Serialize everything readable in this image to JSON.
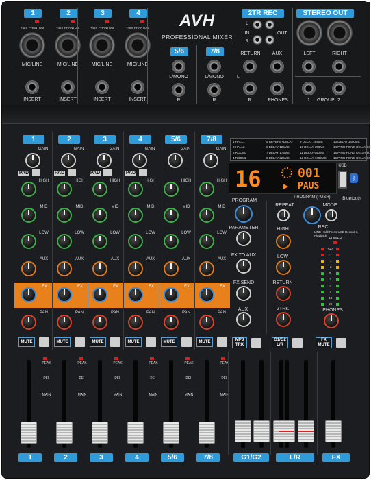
{
  "brand": {
    "logo": "AVH",
    "subtitle": "PROFESSIONAL MIXER"
  },
  "top_panel": {
    "mono_channels": [
      {
        "number": "1",
        "phantom": "+48V PHANTOM",
        "input": "MIC/LINE",
        "insert": "INSERT"
      },
      {
        "number": "2",
        "phantom": "+48V PHANTOM",
        "input": "MIC/LINE",
        "insert": "INSERT"
      },
      {
        "number": "3",
        "phantom": "+48V PHANTOM",
        "input": "MIC/LINE",
        "insert": "INSERT"
      },
      {
        "number": "4",
        "phantom": "+48V PHANTOM",
        "input": "MIC/LINE",
        "insert": "INSERT"
      }
    ],
    "stereo_channels": [
      {
        "number": "5/6",
        "left": "L/MONO",
        "right": "R"
      },
      {
        "number": "7/8",
        "left": "L/MONO",
        "right": "R"
      }
    ],
    "tr2_rec": {
      "title": "2TR REC",
      "in": "IN",
      "out": "OUT",
      "l": "L",
      "r": "R",
      "return": "RETURN",
      "aux": "AUX",
      "phones": "PHONES"
    },
    "stereo_out": {
      "title": "STEREO OUT",
      "left": "LEFT",
      "right": "RIGHT",
      "group": "GROUP",
      "g1": "1",
      "g2": "2"
    }
  },
  "channels": [
    {
      "label": "1",
      "gain": "GAIN",
      "pad": "PAD",
      "high": "HIGH",
      "mid": "MID",
      "low": "LOW",
      "aux": "AUX",
      "fx": "FX",
      "pan": "PAN",
      "mute": "MUTE",
      "peak": "PEAK",
      "pfl": "PFL",
      "main": "MAIN"
    },
    {
      "label": "2",
      "gain": "GAIN",
      "pad": "PAD",
      "high": "HIGH",
      "mid": "MID",
      "low": "LOW",
      "aux": "AUX",
      "fx": "FX",
      "pan": "PAN",
      "mute": "MUTE",
      "peak": "PEAK",
      "pfl": "PFL",
      "main": "MAIN"
    },
    {
      "label": "3",
      "gain": "GAIN",
      "pad": "PAD",
      "high": "HIGH",
      "mid": "MID",
      "low": "LOW",
      "aux": "AUX",
      "fx": "FX",
      "pan": "PAN",
      "mute": "MUTE",
      "peak": "PEAK",
      "pfl": "PFL",
      "main": "MAIN"
    },
    {
      "label": "4",
      "gain": "GAIN",
      "pad": "PAD",
      "high": "HIGH",
      "mid": "MID",
      "low": "LOW",
      "aux": "AUX",
      "fx": "FX",
      "pan": "PAN",
      "mute": "MUTE",
      "peak": "PEAK",
      "pfl": "PFL",
      "main": "MAIN"
    },
    {
      "label": "5/6",
      "gain": "GAIN",
      "pad": "",
      "high": "HIGH",
      "mid": "MID",
      "low": "LOW",
      "aux": "AUX",
      "fx": "FX",
      "pan": "PAN",
      "mute": "MUTE",
      "peak": "PEAK",
      "pfl": "PFL",
      "main": "MAIN"
    },
    {
      "label": "7/8",
      "gain": "GAIN",
      "pad": "",
      "high": "HIGH",
      "mid": "MID",
      "low": "LOW",
      "aux": "AUX",
      "fx": "FX",
      "pan": "PAN",
      "mute": "MUTE",
      "peak": "PEAK",
      "pfl": "PFL",
      "main": "MAIN"
    }
  ],
  "fx_presets": [
    "1 HALL1",
    "2 HALL2",
    "3 ROOM1",
    "4 ROOM2",
    "5 REVERB+DELAY",
    "6 DELAY 125MS",
    "7 DELAY 175MS",
    "8 DELAY 225MS",
    "9 DELAY 285MS",
    "10 DELAY 350MS",
    "11 DELAY 650MS",
    "12 DELAY 1000MS",
    "13 DELAY 1400MS",
    "14 PING-PONG DELAY 600MS",
    "15 PING-PONG DELAY 800MS",
    "16 PING-PONG DELAY 900MS"
  ],
  "display": {
    "preset": "16",
    "track": "001",
    "status": "PAUS",
    "usb": "USB",
    "bluetooth": "Bluetooth"
  },
  "master": {
    "program": "PROGRAM",
    "parameter": "PARAMETER",
    "fx_to_aux": "FX TO AUX",
    "fx_send": "FX SEND",
    "aux": "AUX",
    "repeat": "REPEAT",
    "program_push": "PROGRAM (PUSH)",
    "mode": "MODE",
    "rec": "REC",
    "rec_note": "LINE Hold Press USB Record & Playback",
    "high": "HIGH",
    "low": "LOW",
    "return": "RETURN",
    "tr2": "2TRK",
    "phones": "PHONES",
    "power": "POWER",
    "mp3": "MP3 TRK",
    "g1g2_lr": "G1/G2 L/R",
    "fx_mute": "FX MUTE",
    "meter_scale": [
      "+10",
      "+7",
      "+4",
      "+2",
      "0",
      "-2",
      "-4",
      "-7",
      "-10",
      "-20"
    ]
  },
  "bottom_labels": [
    "1",
    "2",
    "3",
    "4",
    "5/6",
    "7/8",
    "G1/G2",
    "L/R",
    "FX"
  ],
  "colors": {
    "accent_blue": "#2f9bd8",
    "fx_orange": "#e8801c",
    "eq_green": "#3fae4a",
    "display_orange": "#ff8a1e"
  }
}
